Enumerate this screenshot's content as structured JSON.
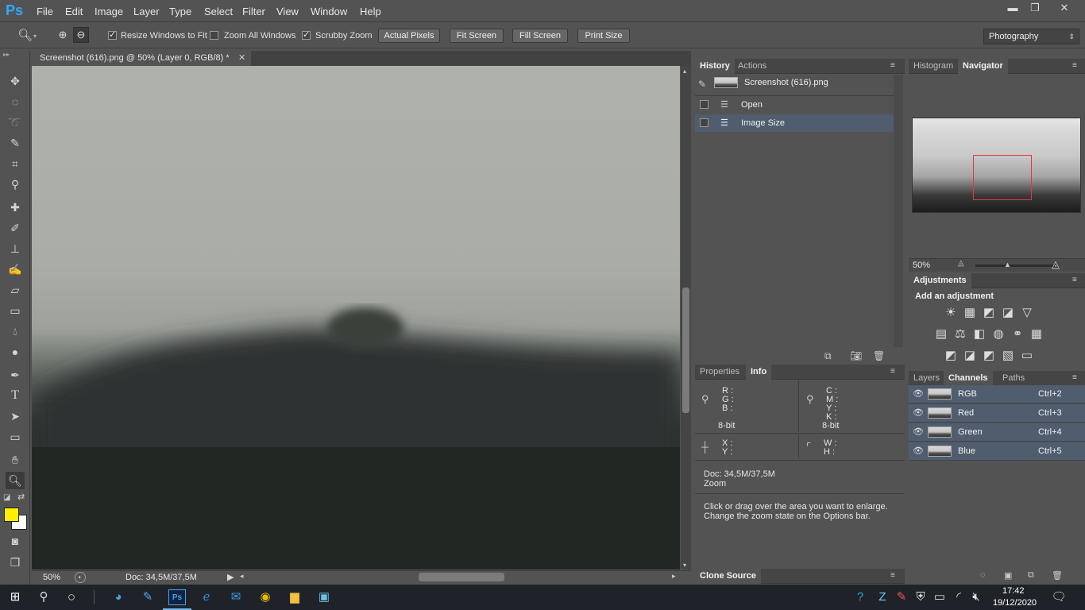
{
  "app": {
    "logo": "Ps"
  },
  "menu": [
    "File",
    "Edit",
    "Image",
    "Layer",
    "Type",
    "Select",
    "Filter",
    "View",
    "Window",
    "Help"
  ],
  "window_controls": {
    "minimize": "▬",
    "restore": "❐",
    "close": "✕"
  },
  "options": {
    "resize_windows_label": "Resize Windows to Fit",
    "zoom_all_label": "Zoom All Windows",
    "scrubby_zoom_label": "Scrubby Zoom",
    "resize_windows_checked": true,
    "zoom_all_checked": false,
    "scrubby_zoom_checked": true,
    "actual_pixels": "Actual Pixels",
    "fit_screen": "Fit Screen",
    "fill_screen": "Fill Screen",
    "print_size": "Print Size",
    "workspace": "Photography"
  },
  "document": {
    "tab_title": "Screenshot (616).png @ 50% (Layer 0, RGB/8) *",
    "zoom": "50%",
    "doc_size": "Doc: 34,5M/37,5M"
  },
  "history": {
    "tabs": [
      "History",
      "Actions"
    ],
    "snapshot": "Screenshot (616).png",
    "items": [
      "Open",
      "Image Size"
    ]
  },
  "info": {
    "tabs": [
      "Properties",
      "Info"
    ],
    "rgb": [
      "R :",
      "G :",
      "B :"
    ],
    "cmyk": [
      "C :",
      "M :",
      "Y :",
      "K :"
    ],
    "bit_left": "8-bit",
    "bit_right": "8-bit",
    "xy": [
      "X :",
      "Y :"
    ],
    "wh": [
      "W :",
      "H :"
    ],
    "doc": "Doc: 34,5M/37,5M",
    "tool": "Zoom",
    "hint1": "Click or drag over the area you want to enlarge.",
    "hint2": "Change the zoom state on the Options bar."
  },
  "clone_source": "Clone Source",
  "navigator": {
    "tabs": [
      "Histogram",
      "Navigator"
    ],
    "zoom": "50%"
  },
  "adjustments": {
    "title": "Adjustments",
    "subtitle": "Add an adjustment"
  },
  "channels": {
    "tabs": [
      "Layers",
      "Channels",
      "Paths"
    ],
    "rows": [
      {
        "name": "RGB",
        "shortcut": "Ctrl+2"
      },
      {
        "name": "Red",
        "shortcut": "Ctrl+3"
      },
      {
        "name": "Green",
        "shortcut": "Ctrl+4"
      },
      {
        "name": "Blue",
        "shortcut": "Ctrl+5"
      }
    ]
  },
  "taskbar": {
    "time": "17:42",
    "date": "19/12/2020"
  },
  "colors": {
    "foreground": "#ffee00",
    "background": "#ffffff",
    "selection": "#4f5d6e",
    "nav_box": "#e0393e"
  }
}
